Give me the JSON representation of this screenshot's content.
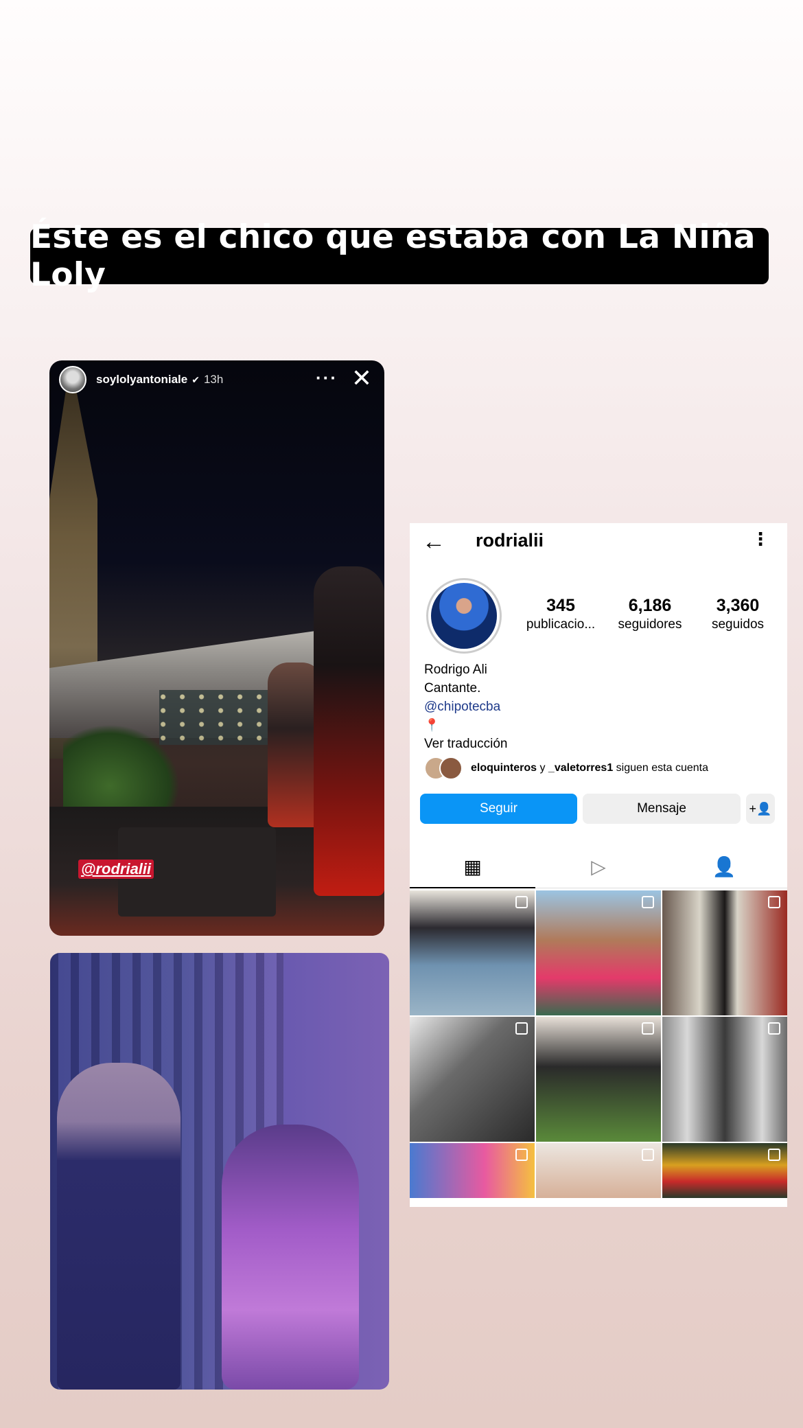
{
  "banner": {
    "text": "Éste es el chico que estaba con La Niña Loly"
  },
  "story1": {
    "username": "soylolyantoniale",
    "time": "13h",
    "more_icon": "more-horizontal-icon",
    "close_icon": "close-icon",
    "mention": "@rodrialii"
  },
  "story2": {},
  "profile": {
    "back_icon": "back-arrow-icon",
    "username": "rodrialii",
    "more_icon": "more-vertical-icon",
    "stats": [
      {
        "value": "345",
        "label": "publicacio..."
      },
      {
        "value": "6,186",
        "label": "seguidores"
      },
      {
        "value": "3,360",
        "label": "seguidos"
      }
    ],
    "bio": {
      "name": "Rodrigo Ali",
      "line": "Cantante.",
      "link": "@chipotecba",
      "translate": "Ver traducción"
    },
    "followed_by": {
      "user1": "eloquinteros",
      "conj": "y",
      "user2": "_valetorres1",
      "suffix": "siguen esta cuenta"
    },
    "buttons": {
      "follow": "Seguir",
      "message": "Mensaje"
    },
    "accent": "#0a95f6"
  }
}
